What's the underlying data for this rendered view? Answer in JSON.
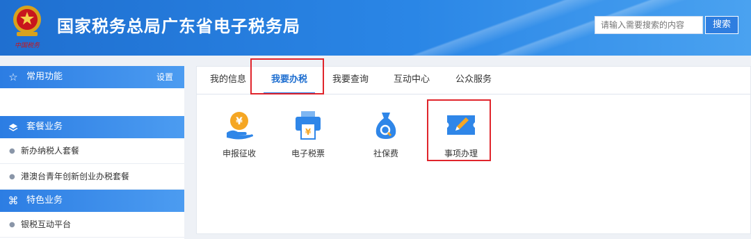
{
  "header": {
    "title": "国家税务总局广东省电子税务局",
    "search_placeholder": "请输入需要搜索的内容",
    "search_button": "搜索",
    "emblem_motto": "中国税务"
  },
  "sidebar": {
    "common": {
      "label": "常用功能",
      "action": "设置",
      "icon": "star-icon"
    },
    "packages": {
      "label": "套餐业务",
      "icon": "layers-icon",
      "items": [
        "新办纳税人套餐",
        "港澳台青年创新创业办税套餐"
      ]
    },
    "special": {
      "label": "特色业务",
      "icon": "grid-knot-icon",
      "items": [
        "银税互动平台"
      ]
    }
  },
  "tabs": [
    "我的信息",
    "我要办税",
    "我要查询",
    "互动中心",
    "公众服务"
  ],
  "active_tab": "我要办税",
  "functions": [
    {
      "label": "申报征收",
      "icon": "coin-hand-icon",
      "color": "#f5a623"
    },
    {
      "label": "电子税票",
      "icon": "printer-ticket-icon",
      "color": "#2f86e8"
    },
    {
      "label": "社保费",
      "icon": "money-bag-icon",
      "color": "#2f86e8"
    },
    {
      "label": "事项办理",
      "icon": "pencil-ticket-icon",
      "color": "#2f86e8"
    }
  ],
  "colors": {
    "brand": "#2a7ee0",
    "highlight": "#e0242b"
  }
}
